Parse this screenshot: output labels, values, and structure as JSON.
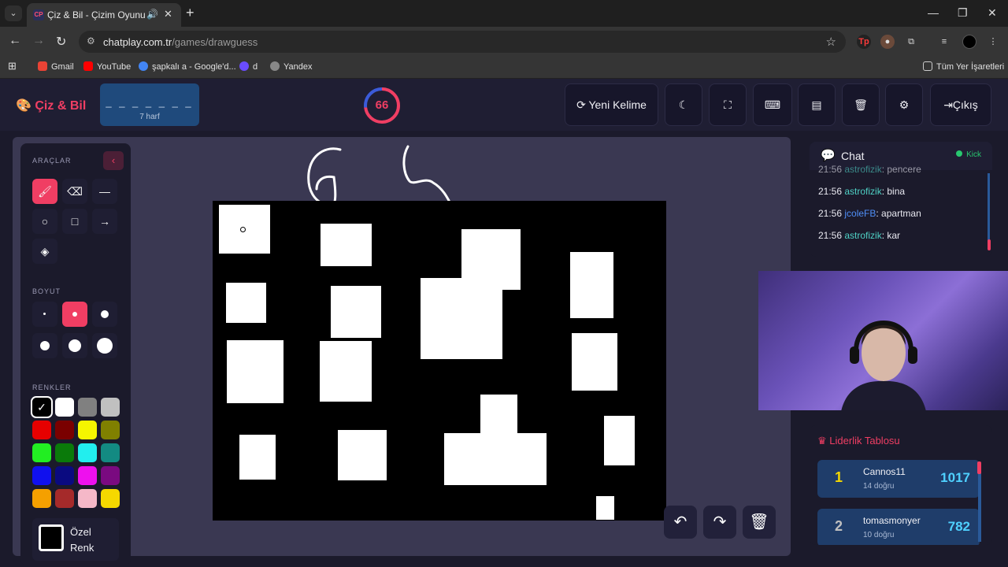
{
  "browser": {
    "tab_title": "Çiz & Bil - Çizim Oyunu",
    "tab_favicon": "CP",
    "url_domain": "chatplay.com.tr",
    "url_path": "/games/drawguess",
    "bookmarks": [
      {
        "label": "Gmail",
        "icon_color": "#ea4335"
      },
      {
        "label": "YouTube",
        "icon_color": "#ff0000"
      },
      {
        "label": "şapkalı a - Google'd...",
        "icon_color": "#4285f4"
      },
      {
        "label": "d",
        "icon_color": "#6a4cff"
      },
      {
        "label": "Yandex",
        "icon_color": "#888888"
      }
    ],
    "all_bookmarks": "Tüm Yer İşaretleri"
  },
  "header": {
    "logo": "Çiz & Bil",
    "word_dashes": "_ _ _ _ _ _ _",
    "word_hint": "7 harf",
    "timer": "66",
    "timer_fraction": 0.73,
    "buttons": {
      "new_word": "Yeni Kelime",
      "exit": "Çıkış"
    }
  },
  "toolbox": {
    "tools_label": "ARAÇLAR",
    "size_label": "BOYUT",
    "colors_label": "RENKLER",
    "custom_color_label_1": "Özel",
    "custom_color_label_2": "Renk",
    "colors": [
      "#000000",
      "#ffffff",
      "#808080",
      "#c0c0c0",
      "#e60000",
      "#7a0000",
      "#f5f500",
      "#808000",
      "#22ee22",
      "#0a7a0a",
      "#22eeee",
      "#138a82",
      "#1010ee",
      "#0a0a80",
      "#ee10ee",
      "#7a0a80",
      "#f5a000",
      "#a52a2a",
      "#f5b8c8",
      "#f5d800"
    ]
  },
  "chat": {
    "title": "Chat",
    "kick": "Kick",
    "messages": [
      {
        "time": "21:56",
        "user": "astrofizik",
        "text": ": pencere"
      },
      {
        "time": "21:56",
        "user": "astrofizik",
        "text": ": bina"
      },
      {
        "time": "21:56",
        "user": "jcoleFB",
        "text": ": apartman"
      },
      {
        "time": "21:56",
        "user": "astrofizik",
        "text": ": kar"
      }
    ]
  },
  "leaderboard": {
    "title": "Liderlik Tablosu",
    "entries": [
      {
        "rank": "1",
        "name": "Cannos11",
        "sub": "14 doğru",
        "score": "1017",
        "rank_color": "#f5d800"
      },
      {
        "rank": "2",
        "name": "tomasmonyer",
        "sub": "10 doğru",
        "score": "782",
        "rank_color": "#c0c0c0"
      }
    ]
  }
}
